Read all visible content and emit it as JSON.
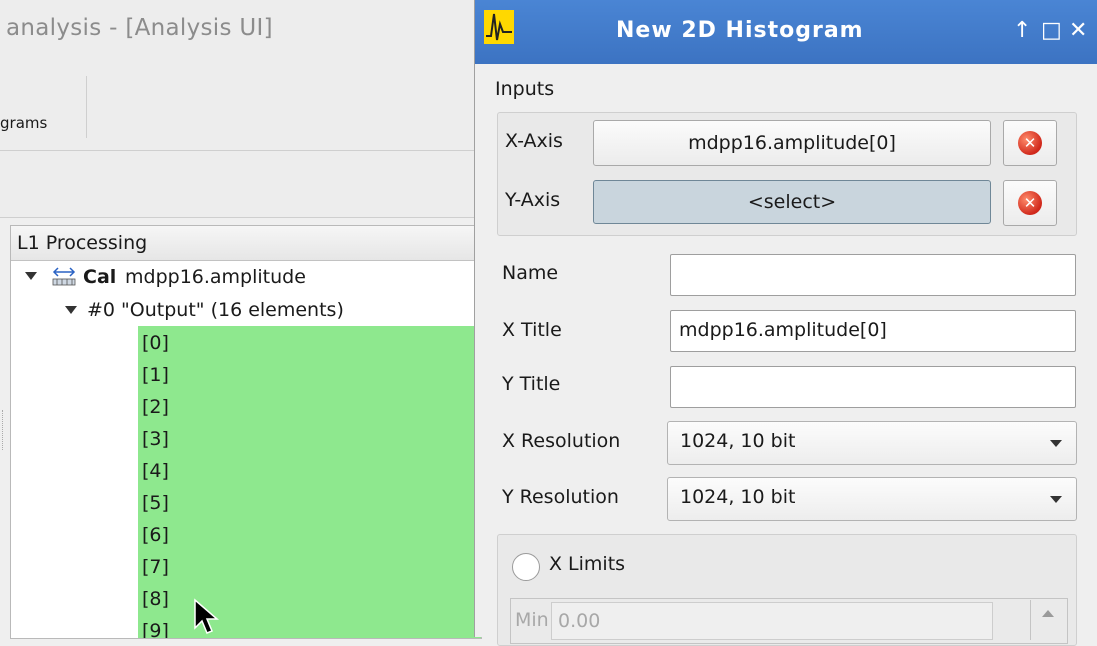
{
  "main_window": {
    "title": "analysis - [Analysis UI]",
    "toolbar_label": "grams"
  },
  "tree": {
    "header": "L1 Processing",
    "root": {
      "kind": "Cal",
      "name": "mdpp16.amplitude",
      "icon": "calibration-icon"
    },
    "output": "#0 \"Output\" (16 elements)",
    "items": [
      "[0]",
      "[1]",
      "[2]",
      "[3]",
      "[4]",
      "[5]",
      "[6]",
      "[7]",
      "[8]",
      "[9]"
    ],
    "highlight_color": "#8ee88e"
  },
  "dialog": {
    "title": "New  2D Histogram",
    "title_bar_color": "#3c73c2",
    "controls": {
      "pin": "↑",
      "maximize": "□",
      "close": "✕"
    },
    "inputs": {
      "label": "Inputs",
      "x_axis_label": "X-Axis",
      "x_axis_value": "mdpp16.amplitude[0]",
      "y_axis_label": "Y-Axis",
      "y_axis_value": "<select>",
      "clear_icon": "clear-icon"
    },
    "name": {
      "label": "Name",
      "value": ""
    },
    "x_title": {
      "label": "X Title",
      "value": "mdpp16.amplitude[0]"
    },
    "y_title": {
      "label": "Y Title",
      "value": ""
    },
    "x_resolution": {
      "label": "X Resolution",
      "value": "1024, 10 bit"
    },
    "y_resolution": {
      "label": "Y Resolution",
      "value": "1024, 10 bit"
    },
    "x_limits": {
      "label": "X Limits",
      "min_label": "Min",
      "min_value": "0.00"
    }
  }
}
